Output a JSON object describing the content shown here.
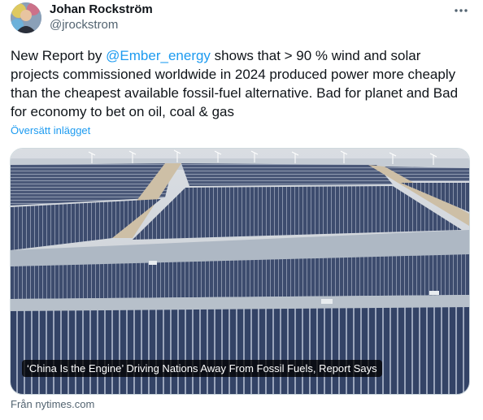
{
  "author": {
    "name": "Johan Rockström",
    "handle": "@jrockstrom"
  },
  "tweet": {
    "text_before_mention": "New Report by ",
    "mention": "@Ember_energy",
    "text_after_mention": " shows that > 90 % wind and solar projects commissioned worldwide in 2024 produced power more cheaply than the cheapest available fossil-fuel alternative. Bad for planet and Bad for economy to bet on oil, coal & gas",
    "translate_label": "Översätt inlägget"
  },
  "card": {
    "headline": "‘China Is the Engine’ Driving Nations Away From Fossil Fuels, Report Says",
    "source": "Från nytimes.com"
  },
  "icons": {
    "more": "more-options-icon",
    "avatar": "avatar-image"
  },
  "colors": {
    "link": "#1d9bf0",
    "secondary_text": "#536471",
    "border": "#cfd9de"
  }
}
